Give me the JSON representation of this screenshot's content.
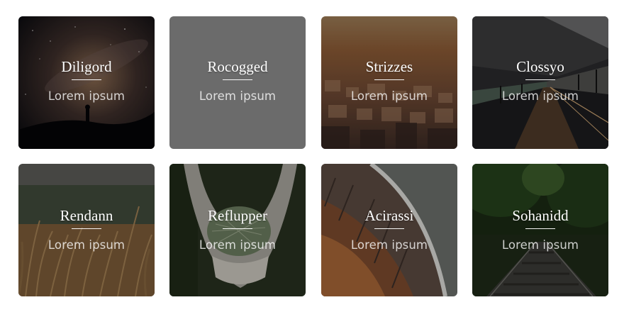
{
  "cards": [
    {
      "title": "Diligord",
      "subtitle": "Lorem ipsum",
      "scene": "starry-night-silhouette"
    },
    {
      "title": "Rocogged",
      "subtitle": "Lorem ipsum",
      "scene": "plain-gray"
    },
    {
      "title": "Strizzes",
      "subtitle": "Lorem ipsum",
      "scene": "city-sunset"
    },
    {
      "title": "Clossyo",
      "subtitle": "Lorem ipsum",
      "scene": "train-platform"
    },
    {
      "title": "Rendann",
      "subtitle": "Lorem ipsum",
      "scene": "wheat-field"
    },
    {
      "title": "Reflupper",
      "subtitle": "Lorem ipsum",
      "scene": "hands-holding-pine"
    },
    {
      "title": "Acirassi",
      "subtitle": "Lorem ipsum",
      "scene": "curved-wooden-structure"
    },
    {
      "title": "Sohanidd",
      "subtitle": "Lorem ipsum",
      "scene": "forest-railway"
    }
  ]
}
